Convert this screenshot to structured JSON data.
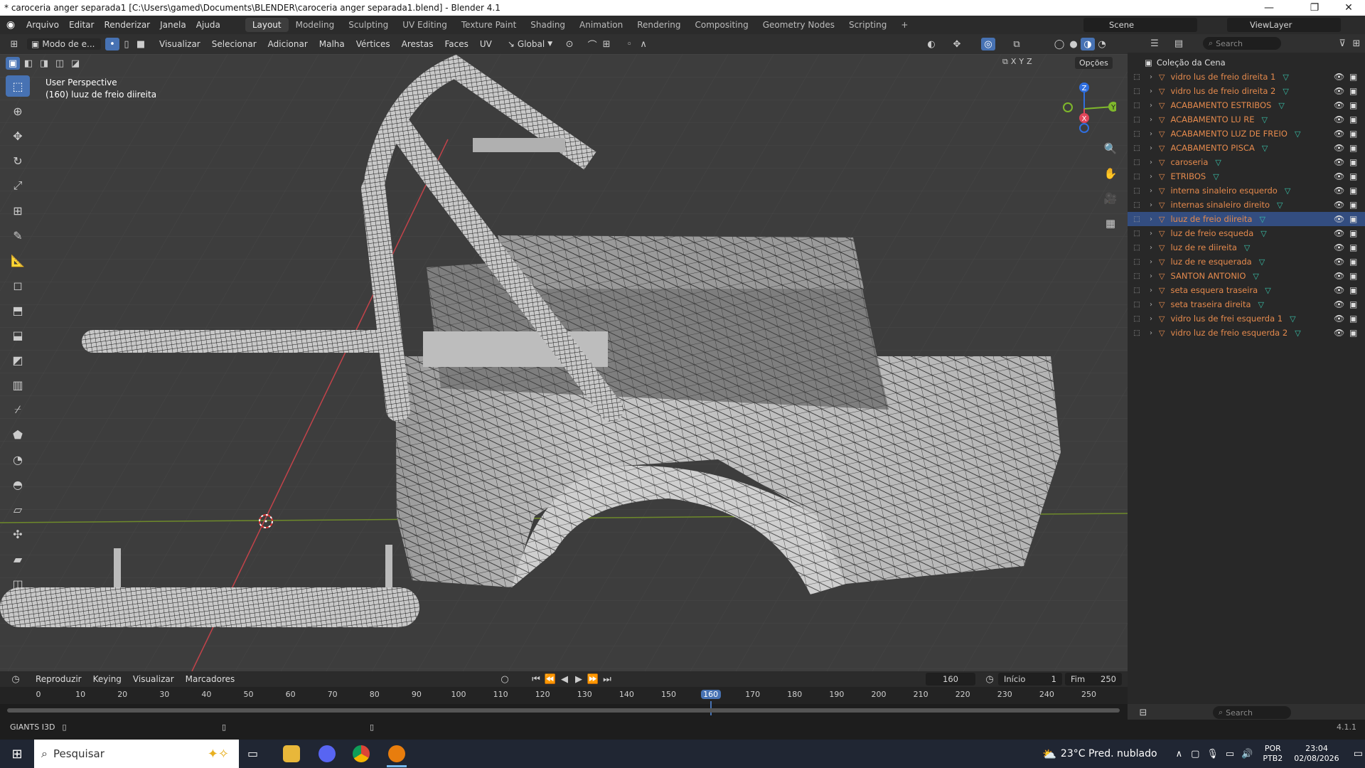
{
  "window": {
    "title": "* caroceria  anger separada1 [C:\\Users\\gamed\\Documents\\BLENDER\\caroceria  anger separada1.blend] - Blender 4.1",
    "min": "—",
    "max": "❐",
    "close": "✕"
  },
  "menu": [
    "Arquivo",
    "Editar",
    "Renderizar",
    "Janela",
    "Ajuda"
  ],
  "workspaces": [
    "Layout",
    "Modeling",
    "Sculpting",
    "UV Editing",
    "Texture Paint",
    "Shading",
    "Animation",
    "Rendering",
    "Compositing",
    "Geometry Nodes",
    "Scripting"
  ],
  "workspace_add": "+",
  "scene": {
    "label": "Scene",
    "view_layer": "ViewLayer"
  },
  "viewport_header": {
    "mode": "Modo de e...",
    "menus": [
      "Visualizar",
      "Selecionar",
      "Adicionar",
      "Malha",
      "Vértices",
      "Arestas",
      "Faces",
      "UV"
    ],
    "transform": "Global"
  },
  "viewport": {
    "view_name": "User Perspective",
    "object_info": "(160) luuz de freio diireita",
    "options": "Opções",
    "axes": [
      "X",
      "Y",
      "Z"
    ]
  },
  "gizmo": {
    "x": "X",
    "y": "Y",
    "z": "Z"
  },
  "outliner": {
    "search_placeholder": "Search",
    "collection": "Coleção da Cena",
    "items": [
      {
        "name": "vidro lus de freio direita 1",
        "selected": false
      },
      {
        "name": "vidro lus de freio direita 2",
        "selected": false
      },
      {
        "name": "ACABAMENTO ESTRIBOS",
        "selected": false
      },
      {
        "name": "ACABAMENTO LU RE",
        "selected": false
      },
      {
        "name": "ACABAMENTO LUZ DE FREIO",
        "selected": false
      },
      {
        "name": "ACABAMENTO PISCA",
        "selected": false
      },
      {
        "name": "caroseria",
        "selected": false
      },
      {
        "name": "ETRIBOS",
        "selected": false
      },
      {
        "name": "interna sinaleiro esquerdo",
        "selected": false
      },
      {
        "name": "internas sinaleiro direito",
        "selected": false
      },
      {
        "name": "luuz de freio diireita",
        "selected": true
      },
      {
        "name": "luz de freio esqueda",
        "selected": false
      },
      {
        "name": "luz de re diireita",
        "selected": false
      },
      {
        "name": "luz de re esquerada",
        "selected": false
      },
      {
        "name": "SANTON ANTONIO",
        "selected": false
      },
      {
        "name": "seta esquera traseira",
        "selected": false
      },
      {
        "name": "seta traseira direita",
        "selected": false
      },
      {
        "name": "vidro lus de frei esquerda 1",
        "selected": false
      },
      {
        "name": "vidro luz de freio esquerda 2",
        "selected": false
      }
    ]
  },
  "properties": {
    "search_placeholder": "Search"
  },
  "timeline": {
    "menus": [
      "Reproduzir",
      "Keying",
      "Visualizar",
      "Marcadores"
    ],
    "current_frame": "160",
    "start_label": "Início",
    "start": "1",
    "end_label": "Fim",
    "end": "250",
    "ticks": [
      "0",
      "10",
      "20",
      "30",
      "40",
      "50",
      "60",
      "70",
      "80",
      "90",
      "100",
      "110",
      "120",
      "130",
      "140",
      "150",
      "160",
      "170",
      "180",
      "190",
      "200",
      "210",
      "220",
      "230",
      "240",
      "250"
    ],
    "current_tick_index": 16
  },
  "status": {
    "left": "GIANTS I3D",
    "version": "4.1.1"
  },
  "taskbar": {
    "search": "Pesquisar",
    "weather": "23°C  Pred. nublado",
    "lang1": "POR",
    "lang2": "PTB2",
    "time": "23:04",
    "date": "02/08/2026"
  }
}
